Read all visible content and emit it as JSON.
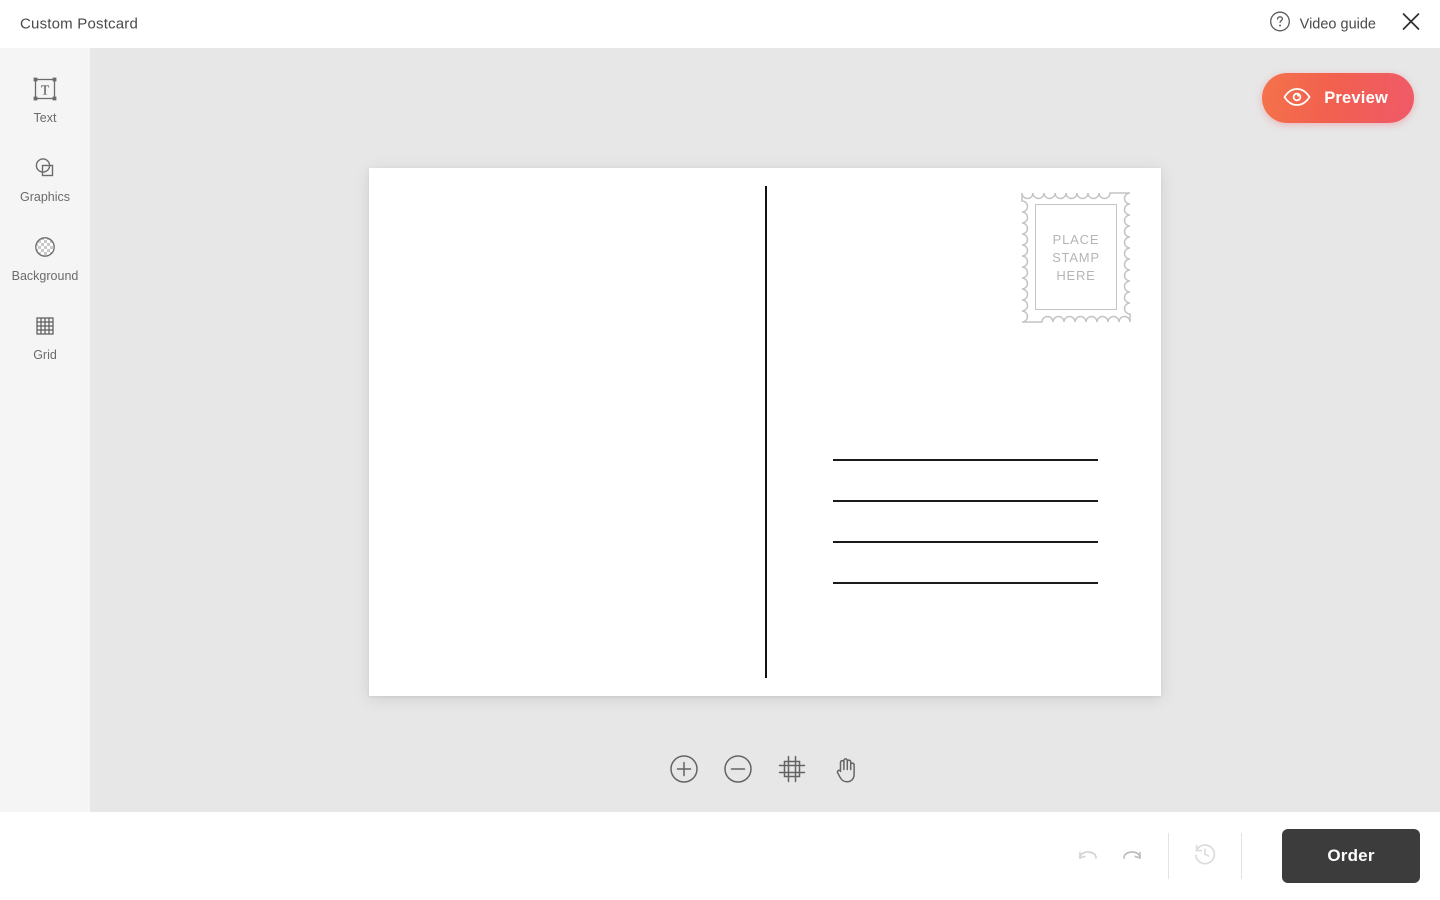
{
  "header": {
    "title": "Custom Postcard",
    "video_guide_label": "Video guide",
    "help_icon": "question-circle-icon",
    "close_icon": "close-icon"
  },
  "sidebar": {
    "items": [
      {
        "label": "Text",
        "icon": "text-frame-icon"
      },
      {
        "label": "Graphics",
        "icon": "shapes-icon"
      },
      {
        "label": "Background",
        "icon": "checkered-circle-icon"
      },
      {
        "label": "Grid",
        "icon": "grid-icon"
      }
    ]
  },
  "canvas": {
    "preview_button": {
      "label": "Preview",
      "icon": "eye-icon"
    },
    "postcard": {
      "stamp": {
        "lines": [
          "PLACE",
          "STAMP",
          "HERE"
        ]
      },
      "address_line_count": 4
    },
    "zoom_tools": [
      {
        "name": "zoom-in",
        "icon": "plus-circle-icon"
      },
      {
        "name": "zoom-out",
        "icon": "minus-circle-icon"
      },
      {
        "name": "fit-to-screen",
        "icon": "crop-frame-icon"
      },
      {
        "name": "pan",
        "icon": "hand-icon"
      }
    ]
  },
  "footer": {
    "undo_icon": "undo-arrow-icon",
    "redo_icon": "redo-arrow-icon",
    "history_icon": "history-clock-icon",
    "order_label": "Order"
  },
  "colors": {
    "accent_gradient_start": "#f4734b",
    "accent_gradient_end": "#ef5a68",
    "order_button": "#3c3c3c",
    "canvas_bg": "#e7e7e7",
    "sidebar_bg": "#f5f5f5"
  }
}
